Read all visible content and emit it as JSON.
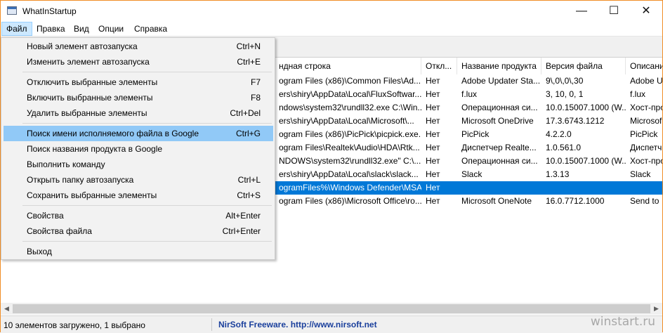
{
  "window": {
    "title": "WhatInStartup",
    "controls": {
      "minimize": "—",
      "maximize": "☐",
      "close": "✕"
    }
  },
  "menubar": [
    {
      "label": "Файл",
      "active": true
    },
    {
      "label": "Правка"
    },
    {
      "label": "Вид"
    },
    {
      "label": "Опции"
    },
    {
      "label": "Справка"
    }
  ],
  "file_menu": {
    "groups": [
      [
        {
          "label": "Новый элемент автозапуска",
          "shortcut": "Ctrl+N"
        },
        {
          "label": "Изменить элемент автозапуска",
          "shortcut": "Ctrl+E"
        }
      ],
      [
        {
          "label": "Отключить выбранные элементы",
          "shortcut": "F7"
        },
        {
          "label": "Включить выбранные элементы",
          "shortcut": "F8"
        },
        {
          "label": "Удалить выбранные элементы",
          "shortcut": "Ctrl+Del"
        }
      ],
      [
        {
          "label": "Поиск имени исполняемого файла в Google",
          "shortcut": "Ctrl+G",
          "highlight": true
        },
        {
          "label": "Поиск названия продукта в Google",
          "shortcut": ""
        },
        {
          "label": "Выполнить команду",
          "shortcut": ""
        },
        {
          "label": "Открыть папку автозапуска",
          "shortcut": "Ctrl+L"
        },
        {
          "label": "Сохранить выбранные элементы",
          "shortcut": "Ctrl+S"
        }
      ],
      [
        {
          "label": "Свойства",
          "shortcut": "Alt+Enter"
        },
        {
          "label": "Свойства файла",
          "shortcut": "Ctrl+Enter"
        }
      ],
      [
        {
          "label": "Выход",
          "shortcut": ""
        }
      ]
    ]
  },
  "table": {
    "columns": [
      "ндная строка",
      "Откл...",
      "Название продукта",
      "Версия файла",
      "Описани"
    ],
    "rows": [
      {
        "cmd": "ogram Files (x86)\\Common Files\\Ad...",
        "disabled": "Нет",
        "product": "Adobe Updater Sta...",
        "version": "9\\,0\\,0\\,30",
        "desc": "Adobe U"
      },
      {
        "cmd": "ers\\shiry\\AppData\\Local\\FluxSoftwar...",
        "disabled": "Нет",
        "product": "f.lux",
        "version": "3, 10, 0, 1",
        "desc": "f.lux"
      },
      {
        "cmd": "ndows\\system32\\rundll32.exe C:\\Win...",
        "disabled": "Нет",
        "product": "Операционная си...",
        "version": "10.0.15007.1000 (W...",
        "desc": "Хост-про"
      },
      {
        "cmd": "ers\\shiry\\AppData\\Local\\Microsoft\\...",
        "disabled": "Нет",
        "product": "Microsoft OneDrive",
        "version": "17.3.6743.1212",
        "desc": "Microsof"
      },
      {
        "cmd": "ogram Files (x86)\\PicPick\\picpick.exe...",
        "disabled": "Нет",
        "product": "PicPick",
        "version": "4.2.2.0",
        "desc": "PicPick"
      },
      {
        "cmd": "ogram Files\\Realtek\\Audio\\HDA\\Rtk...",
        "disabled": "Нет",
        "product": "Диспетчер Realte...",
        "version": "1.0.561.0",
        "desc": "Диспетч"
      },
      {
        "cmd": "NDOWS\\system32\\rundll32.exe\" C:\\...",
        "disabled": "Нет",
        "product": "Операционная си...",
        "version": "10.0.15007.1000 (W...",
        "desc": "Хост-про"
      },
      {
        "cmd": "ers\\shiry\\AppData\\Local\\slack\\slack...",
        "disabled": "Нет",
        "product": "Slack",
        "version": "1.3.13",
        "desc": "Slack"
      },
      {
        "cmd": "ogramFiles%\\Windows Defender\\MSA...",
        "disabled": "Нет",
        "product": "",
        "version": "",
        "desc": "",
        "selected": true
      },
      {
        "cmd": "ogram Files (x86)\\Microsoft Office\\ro...",
        "disabled": "Нет",
        "product": "Microsoft OneNote",
        "version": "16.0.7712.1000",
        "desc": "Send to"
      }
    ]
  },
  "status": {
    "left": "10 элементов загружено, 1 выбрано",
    "right": "NirSoft Freeware.  http://www.nirsoft.net"
  },
  "watermark": "winstart.ru",
  "colors": {
    "selection": "#0078d7",
    "menu_highlight": "#91c9f7",
    "border": "#f18e26",
    "link": "#1a3f9c"
  }
}
